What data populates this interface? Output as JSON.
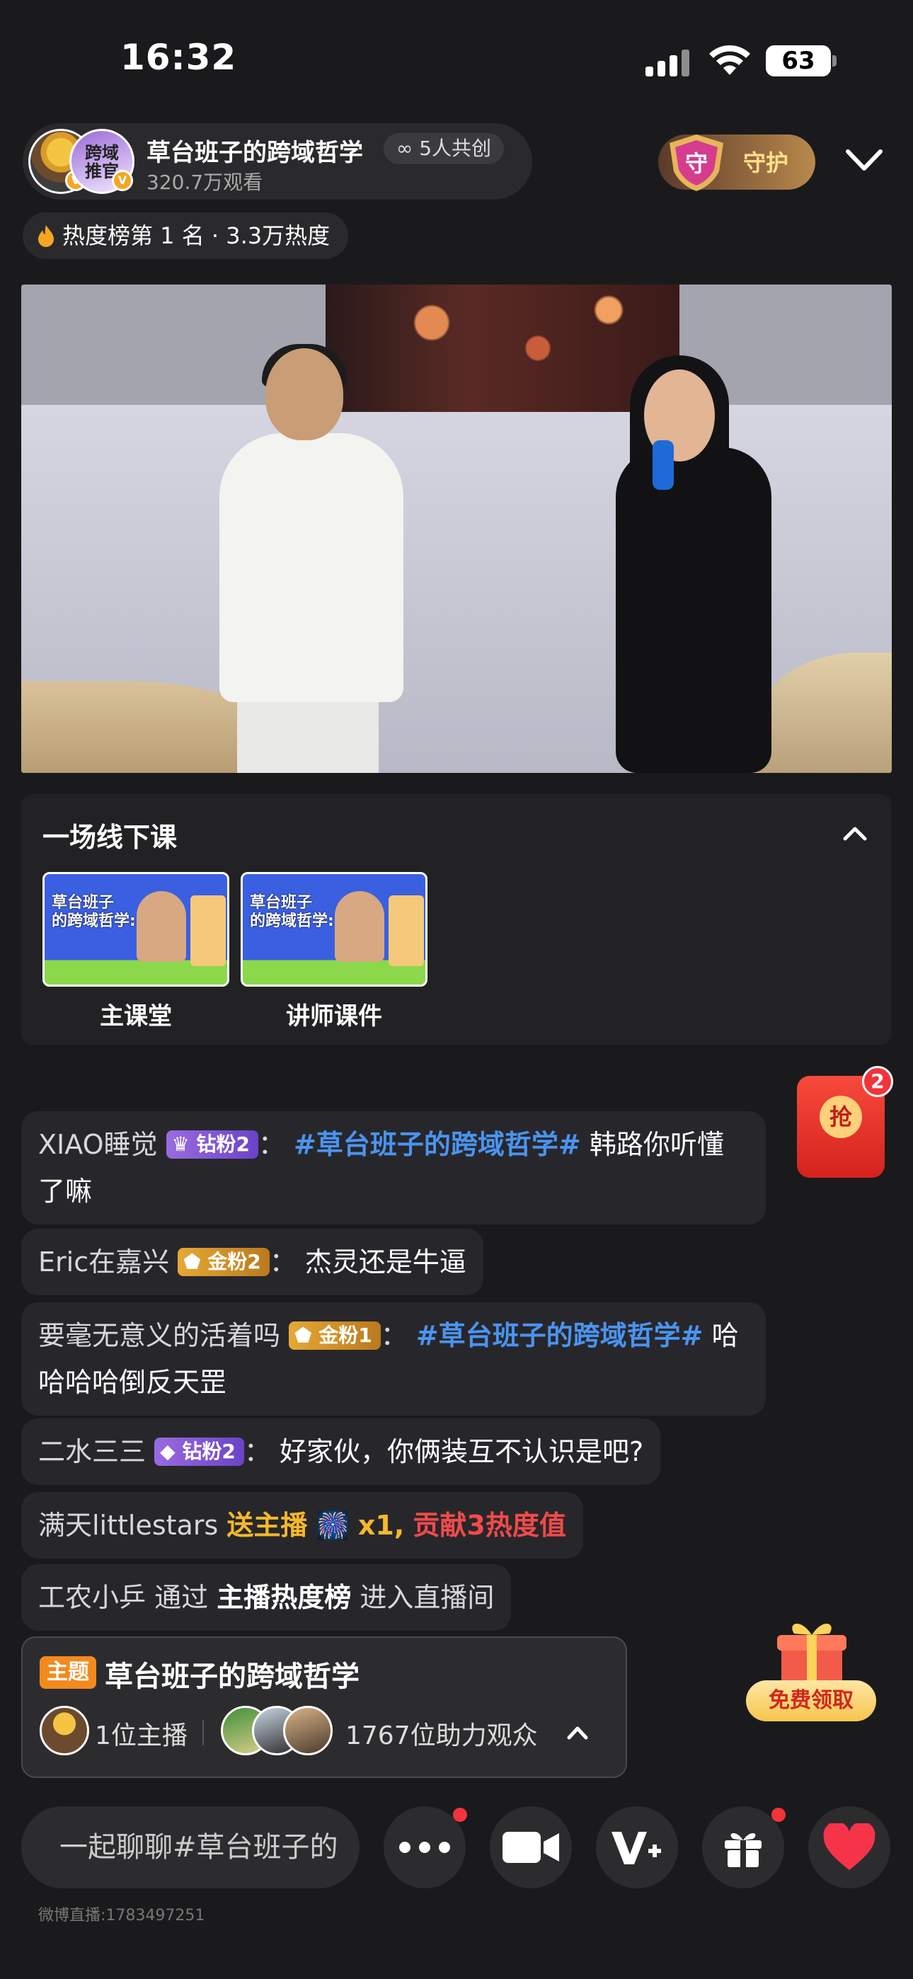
{
  "status_bar": {
    "time": "16:32",
    "battery": "63"
  },
  "header": {
    "host_name": "草台班子的跨域哲学",
    "co_create": "5人共创",
    "viewers": "320.7万观看",
    "avatar2_text": "跨域\n推官",
    "guard_label": "守护",
    "guard_shield_char": "守",
    "hot_rank": "热度榜第 1 名 · 3.3万热度"
  },
  "course": {
    "title": "一场线下课",
    "items": [
      {
        "label": "主课堂",
        "thumb_text": "草台班子\n的跨域哲学:)"
      },
      {
        "label": "讲师课件",
        "thumb_text": "草台班子\n的跨域哲学:)"
      }
    ]
  },
  "comments": [
    {
      "user": "XIAO睡觉",
      "badge": "钻粉2",
      "badge_type": "purple",
      "hashtag": "#草台班子的跨域哲学#",
      "text": "韩路你听懂了嘛"
    },
    {
      "user": "Eric在嘉兴",
      "badge": "金粉2",
      "badge_type": "gold",
      "text": "杰灵还是牛逼"
    },
    {
      "user": "要毫无意义的活着吗",
      "badge": "金粉1",
      "badge_type": "gold",
      "hashtag": "#草台班子的跨域哲学#",
      "text": "哈哈哈哈倒反天罡"
    },
    {
      "user": "二水三三",
      "badge": "钻粉2",
      "badge_type": "purple",
      "text": "好家伙，你俩装互不认识是吧?"
    }
  ],
  "gift_msg": {
    "user": "满天littlestars",
    "action": "送主播",
    "count": "x1,",
    "contrib": "贡献3热度值"
  },
  "enter_msg": {
    "user": "工农小乒",
    "via": "通过",
    "source": "主播热度榜",
    "action": "进入直播间"
  },
  "red_packet": {
    "label": "抢",
    "count": "2"
  },
  "topic": {
    "tag": "主题",
    "title": "草台班子的跨域哲学",
    "hosts": "1位主播",
    "audience": "1767位助力观众"
  },
  "free_gift": {
    "label": "免费领取"
  },
  "bottom": {
    "chat_placeholder": "一起聊聊#草台班子的",
    "footer_id": "微博直播:1783497251"
  },
  "colors": {
    "hashtag": "#4a94f0",
    "gift": "#f5b82a",
    "red": "#f24a4a",
    "accent": "#f28a1e"
  }
}
